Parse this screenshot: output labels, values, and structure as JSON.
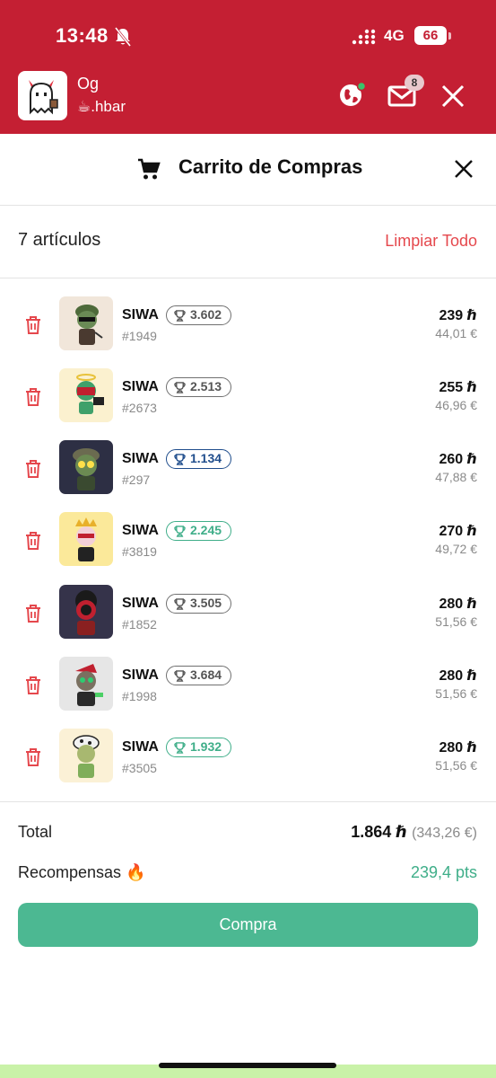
{
  "status_bar": {
    "time": "13:48",
    "network": "4G",
    "battery": "66"
  },
  "header": {
    "user_name": "Og",
    "token_prefix": "☕",
    "token": ".hbar",
    "mail_count": "8"
  },
  "sheet": {
    "title": "Carrito de Compras"
  },
  "summary": {
    "count": "7 artículos",
    "clear_all": "Limpiar Todo"
  },
  "items": [
    {
      "name": "SIWA",
      "id": "#1949",
      "rank": "3.602",
      "price": "239 ℏ",
      "price_eur": "44,01 €",
      "rank_color": "gray"
    },
    {
      "name": "SIWA",
      "id": "#2673",
      "rank": "2.513",
      "price": "255 ℏ",
      "price_eur": "46,96 €",
      "rank_color": "gray"
    },
    {
      "name": "SIWA",
      "id": "#297",
      "rank": "1.134",
      "price": "260 ℏ",
      "price_eur": "47,88 €",
      "rank_color": "blue"
    },
    {
      "name": "SIWA",
      "id": "#3819",
      "rank": "2.245",
      "price": "270 ℏ",
      "price_eur": "49,72 €",
      "rank_color": "green"
    },
    {
      "name": "SIWA",
      "id": "#1852",
      "rank": "3.505",
      "price": "280 ℏ",
      "price_eur": "51,56 €",
      "rank_color": "gray"
    },
    {
      "name": "SIWA",
      "id": "#1998",
      "rank": "3.684",
      "price": "280 ℏ",
      "price_eur": "51,56 €",
      "rank_color": "gray"
    },
    {
      "name": "SIWA",
      "id": "#3505",
      "rank": "1.932",
      "price": "280 ℏ",
      "price_eur": "51,56 €",
      "rank_color": "green"
    }
  ],
  "totals": {
    "total_label": "Total",
    "total_value": "1.864 ℏ",
    "total_eur": "(343,26 €)",
    "rewards_label": "Recompensas 🔥",
    "rewards_value": "239,4 pts"
  },
  "buy_button": "Compra",
  "colors": {
    "header": "#c41f33",
    "accent_red": "#e5484d",
    "accent_green": "#4cb892",
    "rank_blue": "#1f4d8c"
  }
}
